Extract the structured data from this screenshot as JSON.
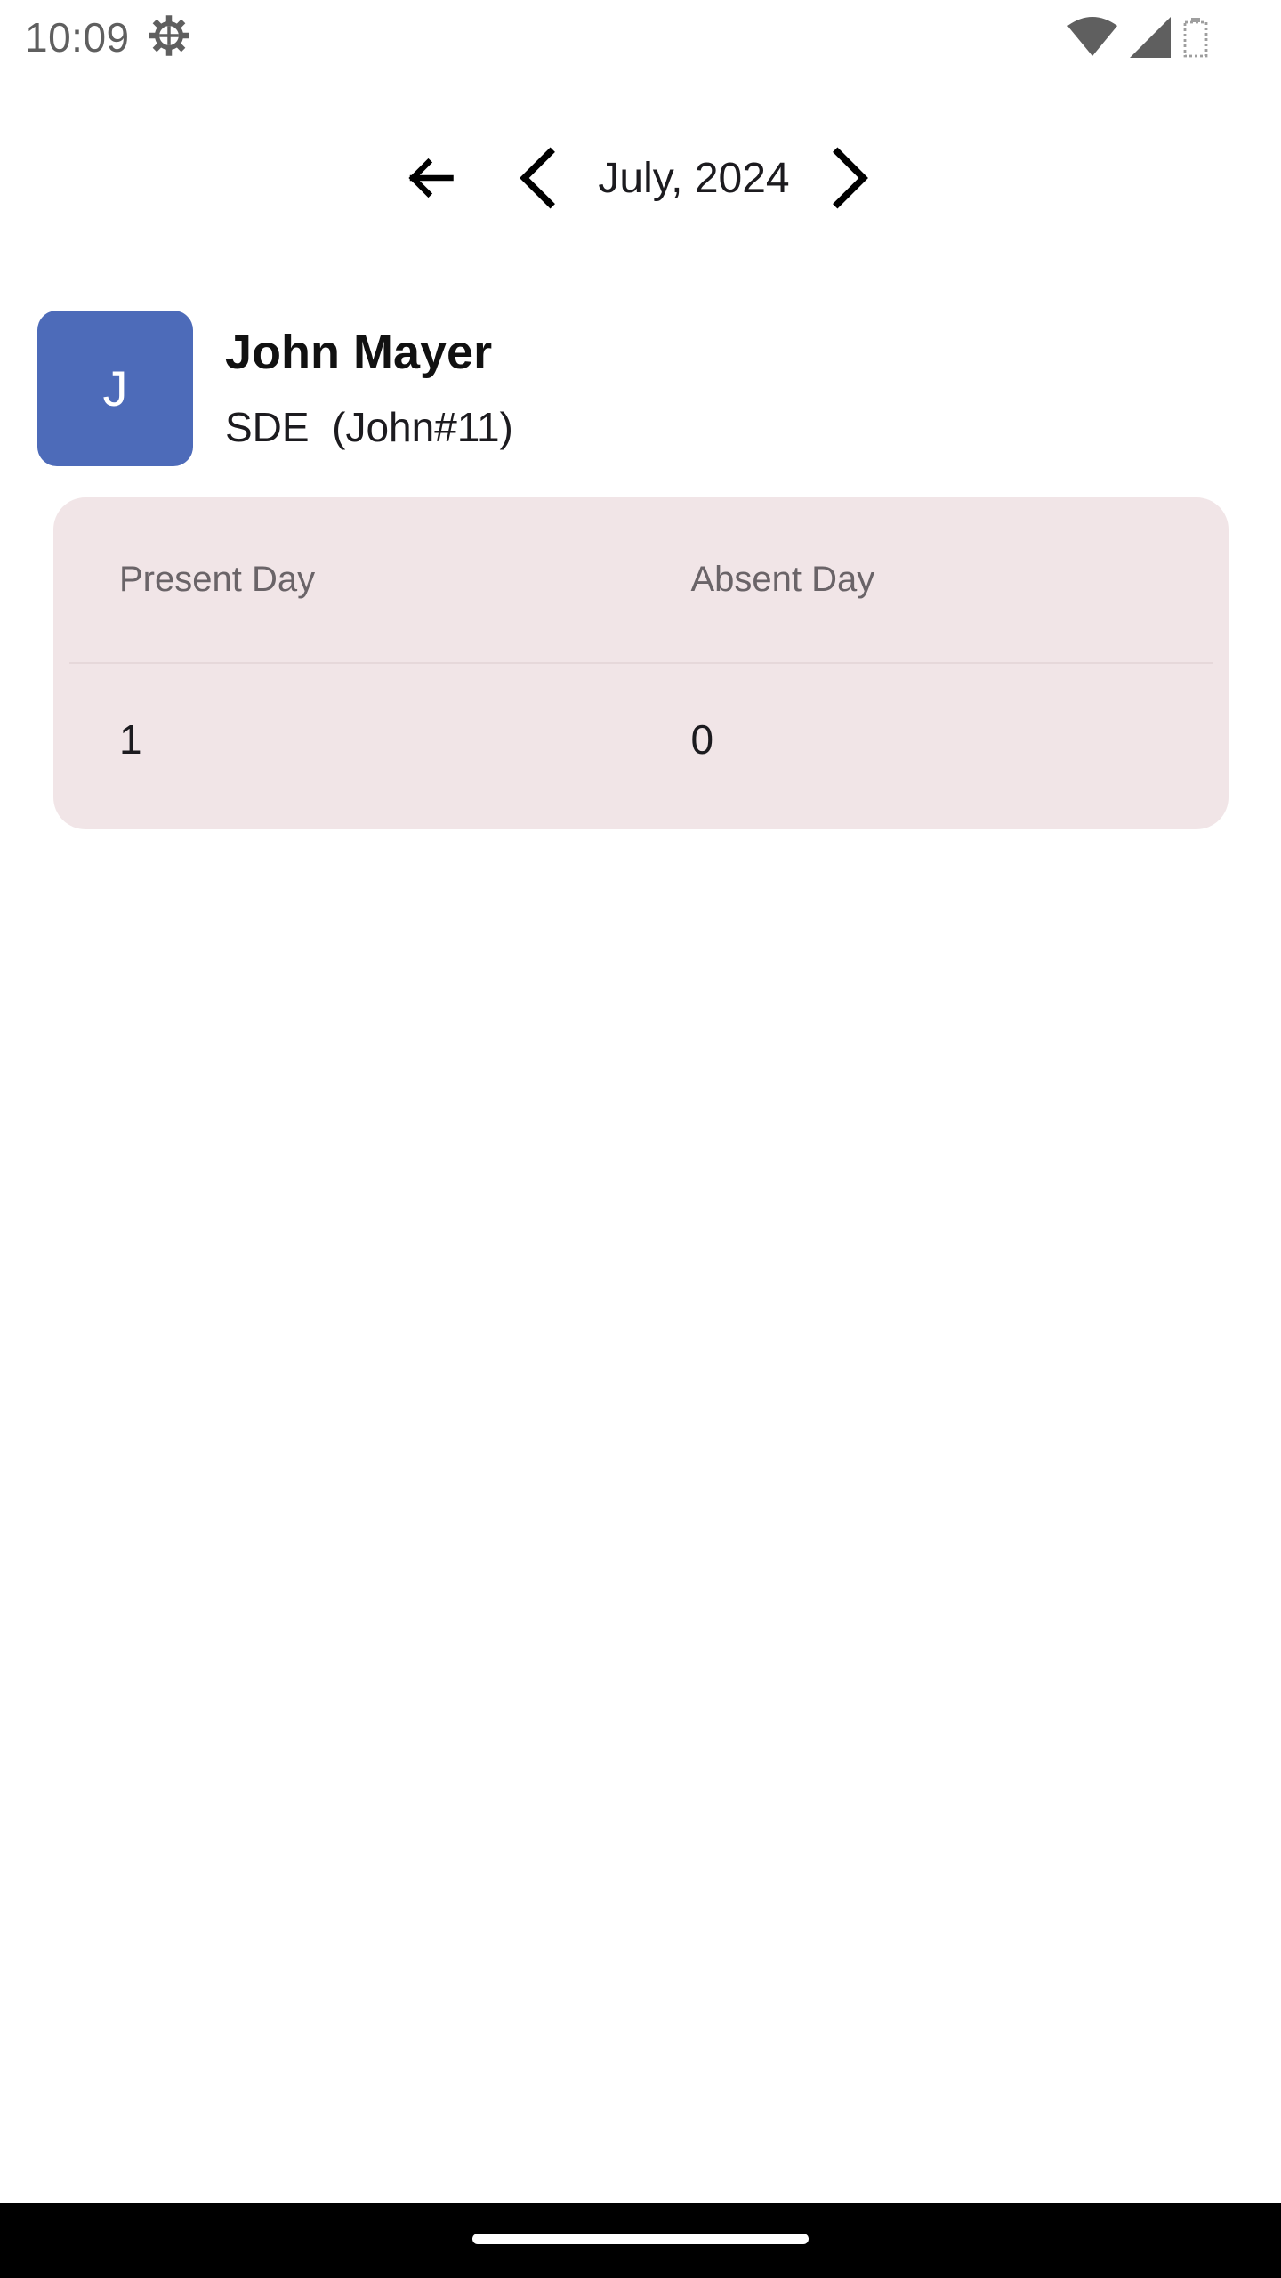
{
  "status_bar": {
    "time": "10:09",
    "icons": [
      "settings-gear-icon",
      "wifi-icon",
      "cell-signal-icon",
      "battery-icon"
    ]
  },
  "month_nav": {
    "back_icon": "arrow-back-icon",
    "prev_icon": "chevron-left-icon",
    "month_label": "July, 2024",
    "next_icon": "chevron-right-icon"
  },
  "employee": {
    "avatar_initial": "J",
    "avatar_color": "#4d6bb9",
    "name": "John Mayer",
    "subtitle": "SDE  (John#11)"
  },
  "stats": {
    "headers": [
      "Present Day",
      "Absent Day"
    ],
    "values": [
      "1",
      "0"
    ],
    "card_color": "#f1e5e7"
  }
}
